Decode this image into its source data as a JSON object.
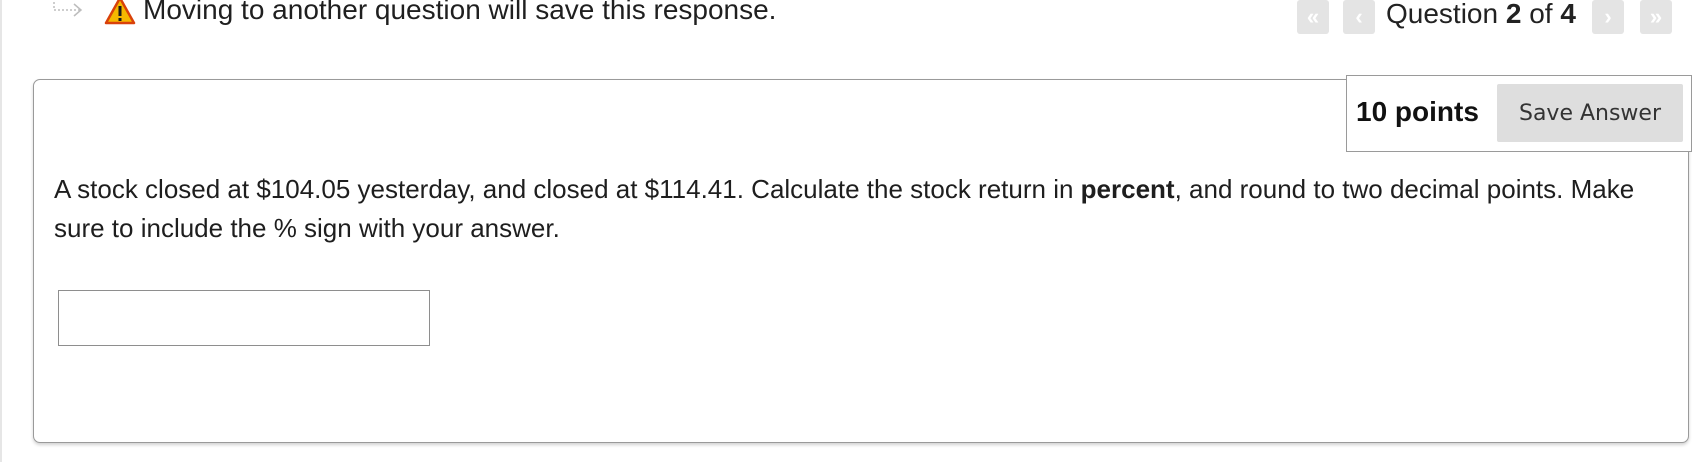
{
  "warning": {
    "icon": "warning-icon",
    "text": "Moving to another question will save this response."
  },
  "navigation": {
    "first_icon": "double-chevron-left-icon",
    "prev_icon": "chevron-left-icon",
    "next_icon": "chevron-right-icon",
    "last_icon": "double-chevron-right-icon",
    "question_word": "Question",
    "current": "2",
    "of_word": "of",
    "total": "4"
  },
  "question": {
    "points": "10 points",
    "save_label": "Save Answer",
    "prompt_part1": "A stock closed at $104.05 yesterday, and closed at $114.41. Calculate the stock return in ",
    "prompt_bold": "percent",
    "prompt_part2": ", and round to two decimal points. Make sure to include the % sign with your answer.",
    "answer_value": ""
  },
  "colors": {
    "warning_yellow": "#f5b800",
    "warning_border": "#d9410a",
    "nav_button_bg": "#e4e4e4",
    "save_button_bg": "#dedede"
  }
}
